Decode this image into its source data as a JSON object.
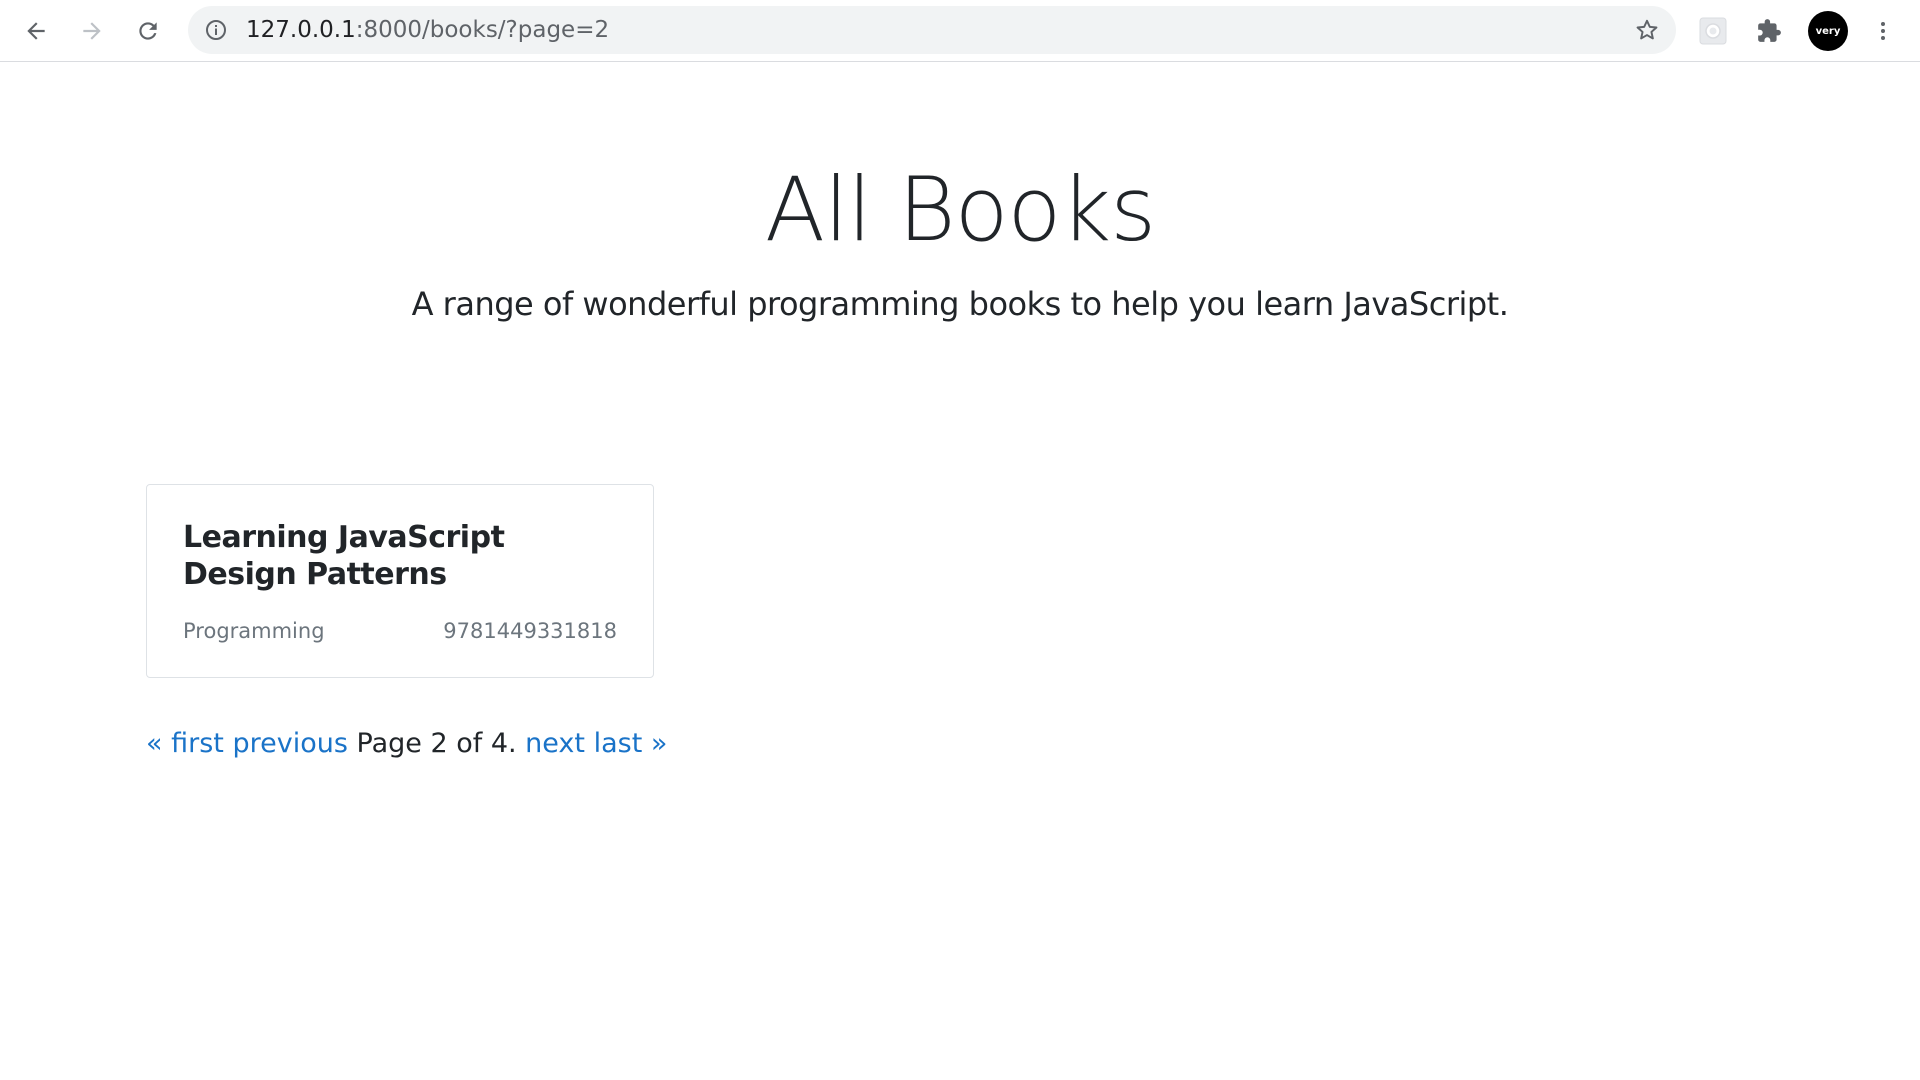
{
  "browser": {
    "url_host": "127.0.0.1",
    "url_path": ":8000/books/?page=2",
    "profile_label": "very",
    "icons": {
      "back": "arrow-left-icon",
      "forward": "arrow-right-icon",
      "reload": "reload-icon",
      "site_info": "info-icon",
      "bookmark": "star-icon",
      "screenshot_extension": "camera-icon",
      "extensions": "puzzle-icon",
      "menu": "kebab-menu-icon"
    }
  },
  "page": {
    "title": "All Books",
    "lead": "A range of wonderful programming books to help you learn JavaScript."
  },
  "books": [
    {
      "title": "Learning JavaScript Design Patterns",
      "category": "Programming",
      "isbn": "9781449331818"
    }
  ],
  "pagination": {
    "first_label": "« first",
    "previous_label": "previous",
    "status": "Page 2 of 4.",
    "next_label": "next",
    "last_label": "last »"
  },
  "colors": {
    "link": "#1a73c8",
    "text": "#212529",
    "muted": "#6c757d",
    "card_border": "#dee2e6",
    "omnibox_bg": "#f1f3f4"
  }
}
